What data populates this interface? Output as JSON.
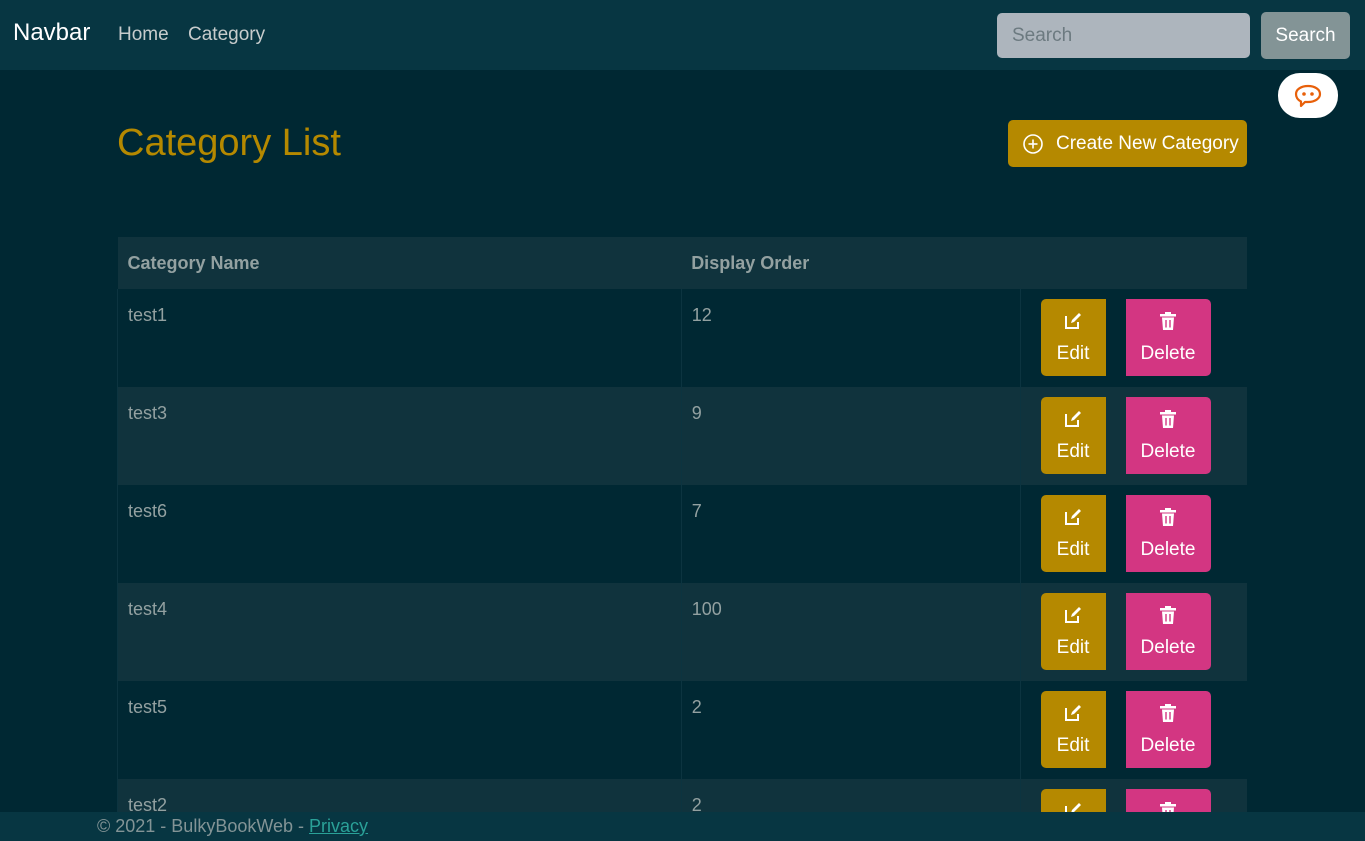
{
  "navbar": {
    "brand": "Navbar",
    "links": [
      {
        "label": "Home"
      },
      {
        "label": "Category"
      }
    ],
    "search_placeholder": "Search",
    "search_button": "Search"
  },
  "page": {
    "title": "Category List",
    "create_button": "Create New Category"
  },
  "table": {
    "headers": [
      "Category Name",
      "Display Order",
      ""
    ],
    "rows": [
      {
        "name": "test1",
        "order": "12"
      },
      {
        "name": "test3",
        "order": "9"
      },
      {
        "name": "test6",
        "order": "7"
      },
      {
        "name": "test4",
        "order": "100"
      },
      {
        "name": "test5",
        "order": "2"
      },
      {
        "name": "test2",
        "order": "2"
      }
    ],
    "edit_label": "Edit",
    "delete_label": "Delete"
  },
  "footer": {
    "text": "© 2021 - BulkyBookWeb - ",
    "link": "Privacy"
  },
  "colors": {
    "background": "#002833",
    "navbar": "#073642",
    "warning": "#b58900",
    "danger": "#d33682",
    "accent_link": "#2aa198",
    "chat_icon": "#e8600a"
  }
}
